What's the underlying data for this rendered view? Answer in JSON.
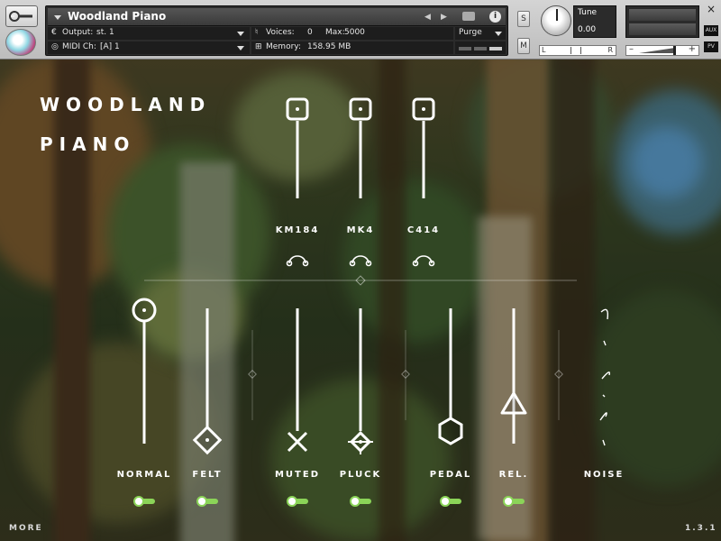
{
  "header": {
    "instrument_name": "Woodland Piano",
    "output_label": "Output:",
    "output_value": "st. 1",
    "midi_label": "MIDI Ch:",
    "midi_value": "[A]  1",
    "voices_label": "Voices:",
    "voices_value": "0",
    "max_label": "Max:",
    "max_value": "5000",
    "memory_label": "Memory:",
    "memory_value": "158.95 MB",
    "purge_label": "Purge",
    "info_label": "i",
    "solo_label": "S",
    "mute_label": "M",
    "tune_label": "Tune",
    "tune_value": "0.00",
    "pan_left": "L",
    "pan_right": "R",
    "vol_minus": "–",
    "vol_plus": "+",
    "close_label": "×",
    "aux_label": "AUX",
    "pv_label": "PV"
  },
  "title_line1": "WOODLAND",
  "title_line2": "PIANO",
  "mics": [
    {
      "label": "KM184"
    },
    {
      "label": "MK4"
    },
    {
      "label": "C414"
    }
  ],
  "articulations": [
    {
      "label": "NORMAL",
      "enabled": true
    },
    {
      "label": "FELT",
      "enabled": true
    },
    {
      "label": "MUTED",
      "enabled": true
    },
    {
      "label": "PLUCK",
      "enabled": true
    },
    {
      "label": "PEDAL",
      "enabled": true
    },
    {
      "label": "REL.",
      "enabled": true
    },
    {
      "label": "NOISE",
      "enabled": true
    }
  ],
  "footer": {
    "more_label": "MORE",
    "version": "1.3.1"
  },
  "colors": {
    "toggle_on": "#8bd458",
    "ui_white": "#ffffff",
    "kontakt_panel": "#2b2b2b"
  }
}
